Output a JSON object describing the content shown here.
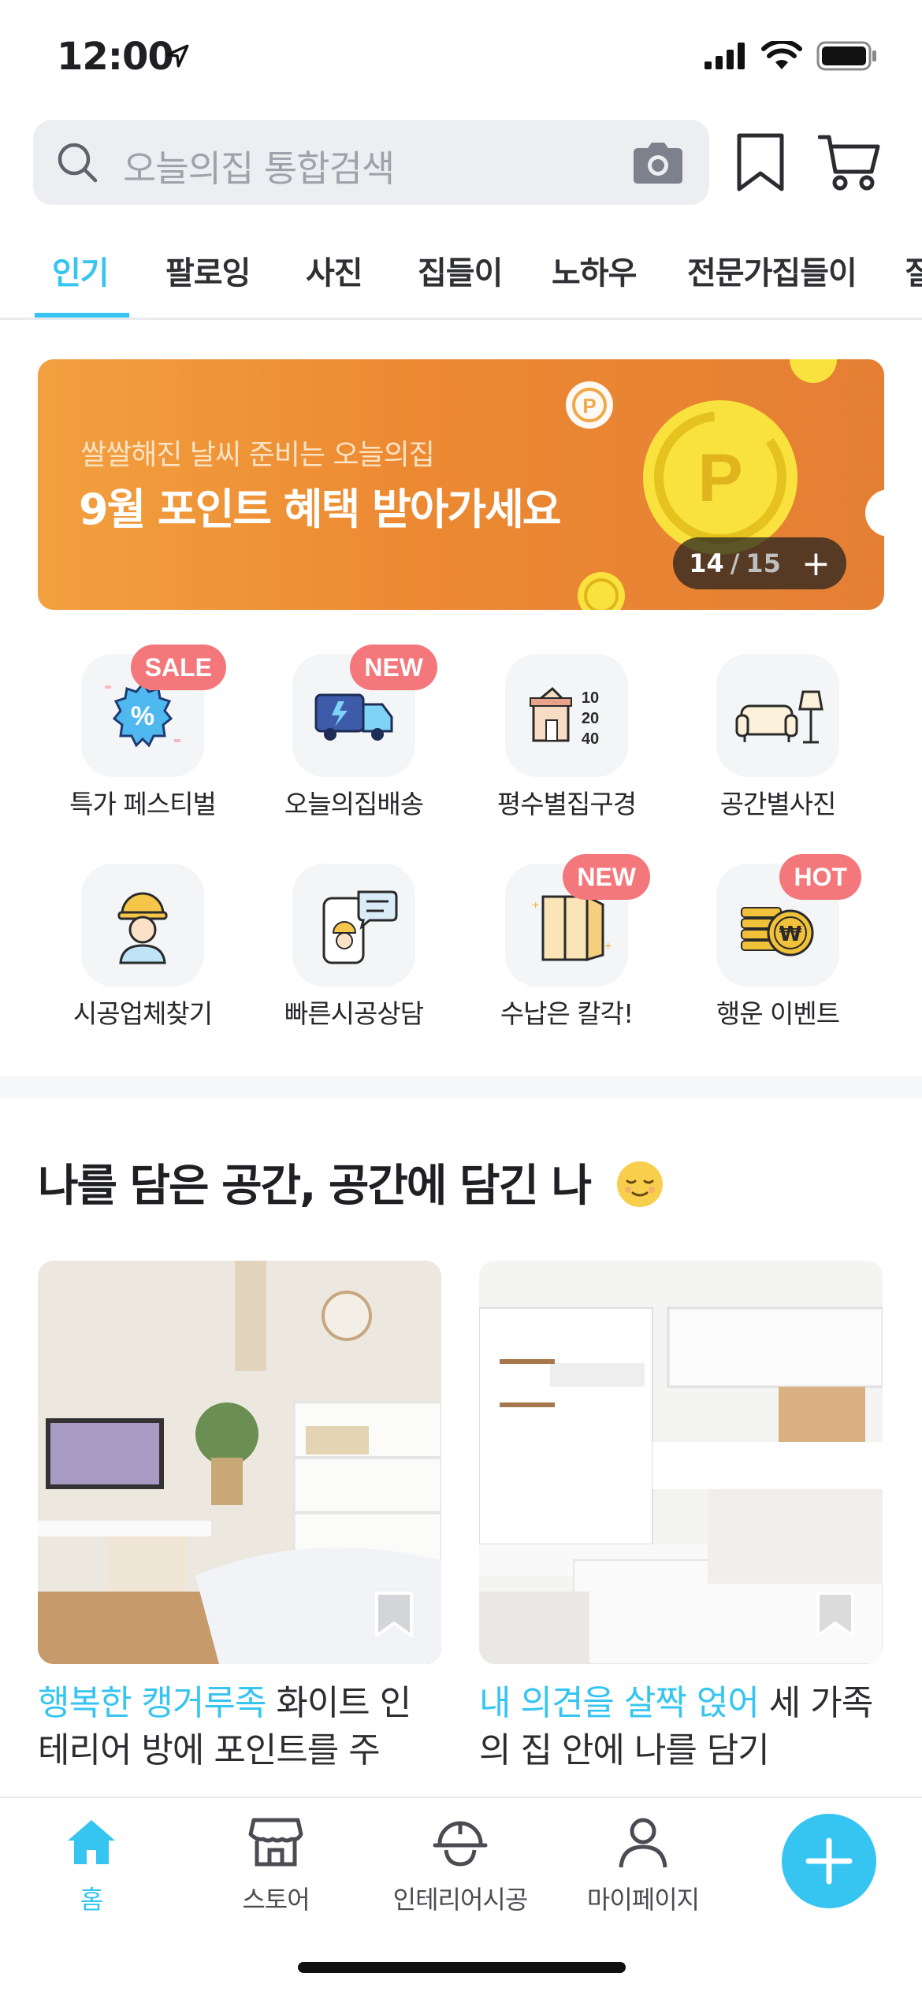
{
  "status_bar": {
    "time": "12:00"
  },
  "search": {
    "placeholder": "오늘의집 통합검색"
  },
  "tabs": [
    {
      "label": "인기",
      "active": true
    },
    {
      "label": "팔로잉",
      "active": false
    },
    {
      "label": "사진",
      "active": false
    },
    {
      "label": "집들이",
      "active": false
    },
    {
      "label": "노하우",
      "active": false
    },
    {
      "label": "전문가집들이",
      "active": false
    },
    {
      "label": "질",
      "active": false
    }
  ],
  "banner": {
    "subtitle": "쌀쌀해진 날씨 준비는 오늘의집",
    "title": "9월 포인트 혜택 받아가세요",
    "current": "14",
    "total": "15",
    "separator": "/",
    "plus": "+"
  },
  "categories": [
    {
      "label": "특가 페스티벌",
      "badge": "SALE",
      "icon": "sale-percent-icon"
    },
    {
      "label": "오늘의집배송",
      "badge": "NEW",
      "icon": "delivery-truck-icon"
    },
    {
      "label": "평수별집구경",
      "badge": "",
      "icon": "house-size-icon",
      "sizes": [
        "10",
        "20",
        "40"
      ]
    },
    {
      "label": "공간별사진",
      "badge": "",
      "icon": "sofa-lamp-icon"
    },
    {
      "label": "시공업체찾기",
      "badge": "",
      "icon": "worker-icon"
    },
    {
      "label": "빠른시공상담",
      "badge": "",
      "icon": "chat-phone-icon"
    },
    {
      "label": "수납은 칼각!",
      "badge": "NEW",
      "icon": "cabinet-icon"
    },
    {
      "label": "행운 이벤트",
      "badge": "HOT",
      "icon": "coins-icon"
    }
  ],
  "feed": {
    "title": "나를 담은 공간, 공간에 담긴 나",
    "emoji": "relieved-face-icon",
    "cards": [
      {
        "accent": "행복한 캥거루족",
        "text": " 화이트 인테리어 방에 포인트를 주는…"
      },
      {
        "accent": "내 의견을 살짝 얹어",
        "text": " 세 가족의 집 안에 나를 담기"
      }
    ]
  },
  "bottom_nav": [
    {
      "label": "홈",
      "icon": "home-icon",
      "active": true
    },
    {
      "label": "스토어",
      "icon": "store-icon",
      "active": false
    },
    {
      "label": "인테리어시공",
      "icon": "helmet-icon",
      "active": false
    },
    {
      "label": "마이페이지",
      "icon": "person-icon",
      "active": false
    }
  ],
  "colors": {
    "accent": "#35c5f0",
    "badge": "#f3777b",
    "banner": "#ec8932"
  }
}
